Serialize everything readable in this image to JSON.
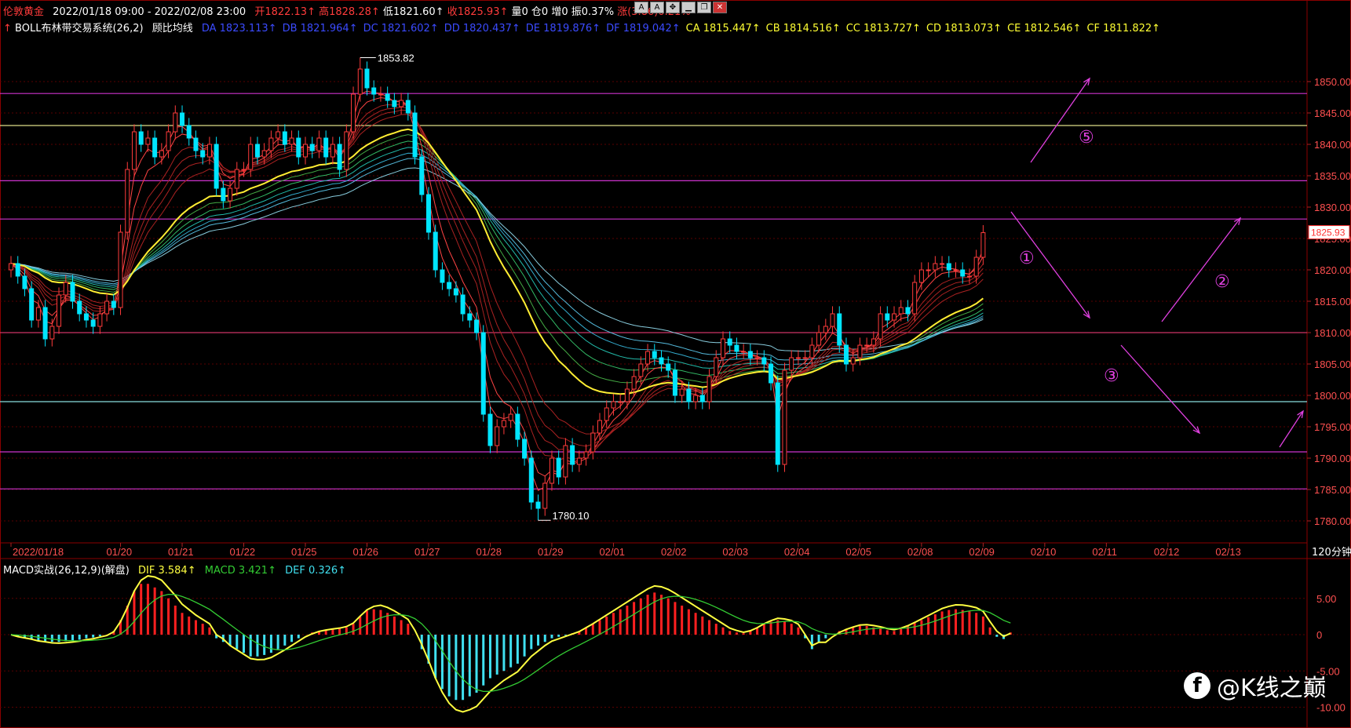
{
  "header": {
    "instrument": "伦敦黄金",
    "range": "2022/01/18 09:00 - 2022/02/08 23:00",
    "open": "开1822.13↑",
    "high": "高1828.28↑",
    "low": "低1821.60↑",
    "close": "收1825.93↑",
    "volume": "量0",
    "position": "仓0",
    "increase": "增0",
    "amplitude": "振0.37%",
    "change": "涨(3.86)0.21%",
    "colors": {
      "up": "#ff3b3b",
      "down": "#00e5ff",
      "label": "#ffffff"
    }
  },
  "indicator": {
    "name": "BOLL布林带交易系统(26,2)",
    "sub": "顾比均线",
    "items": [
      {
        "text": "DA 1823.113↑",
        "color": "#3b4bff"
      },
      {
        "text": "DB 1821.964↑",
        "color": "#3b4bff"
      },
      {
        "text": "DC 1821.602↑",
        "color": "#3b4bff"
      },
      {
        "text": "DD 1820.437↑",
        "color": "#3b4bff"
      },
      {
        "text": "DE 1819.876↑",
        "color": "#3b4bff"
      },
      {
        "text": "DF 1819.042↑",
        "color": "#3b4bff"
      },
      {
        "text": "CA 1815.447↑",
        "color": "#ffff33"
      },
      {
        "text": "CB 1814.516↑",
        "color": "#ffff33"
      },
      {
        "text": "CC 1813.727↑",
        "color": "#ffff33"
      },
      {
        "text": "CD 1813.073↑",
        "color": "#ffff33"
      },
      {
        "text": "CE 1812.546↑",
        "color": "#ffff33"
      },
      {
        "text": "CF 1811.822↑",
        "color": "#ffff33"
      }
    ]
  },
  "window_buttons": [
    "A",
    "A",
    "✥",
    "▁",
    "❐",
    "✕"
  ],
  "chart_data": {
    "type": "candlestick",
    "timeframe": "120分钟",
    "ylim": [
      1776.5,
      1857.5
    ],
    "yticks": [
      1850,
      1845,
      1840,
      1835,
      1830,
      1825,
      1820,
      1815,
      1810,
      1805,
      1800,
      1795,
      1790,
      1785,
      1780
    ],
    "ytick_labels": [
      "1850.00",
      "1845.00",
      "1840.00",
      "1835.00",
      "1830.00",
      "1825.00",
      "1820.00",
      "1815.00",
      "1810.00",
      "1805.00",
      "1800.00",
      "1795.00",
      "1790.00",
      "1785.00",
      "1780.00"
    ],
    "x_labels": [
      "2022/01/18",
      "01/20",
      "01/21",
      "01/22",
      "01/25",
      "01/26",
      "01/27",
      "01/28",
      "01/29",
      "02/01",
      "02/02",
      "02/03",
      "02/04",
      "02/05",
      "02/08",
      "02/09",
      "02/10",
      "02/11",
      "02/12",
      "02/13"
    ],
    "x_index": [
      0,
      16,
      25,
      34,
      43,
      52,
      61,
      70,
      79,
      88,
      97,
      106,
      115,
      124,
      133,
      142,
      151,
      160,
      169,
      178
    ],
    "last_price": "1825.93",
    "high_label": "1853.82",
    "low_label": "1780.10",
    "high_value": 1853.82,
    "low_value": 1780.1,
    "high_index": 51,
    "low_index": 77,
    "closes": [
      1821,
      1819,
      1817,
      1812,
      1814,
      1809,
      1811,
      1816,
      1818,
      1815,
      1813,
      1812,
      1811,
      1813,
      1815,
      1814,
      1826,
      1836,
      1842,
      1840,
      1841,
      1838,
      1839,
      1842,
      1845,
      1843,
      1841,
      1839,
      1838,
      1840,
      1833,
      1831,
      1833,
      1836,
      1836,
      1840,
      1838,
      1839,
      1841,
      1842,
      1840,
      1841,
      1838,
      1840,
      1839,
      1841,
      1838,
      1840,
      1836,
      1842,
      1848,
      1852,
      1849,
      1848,
      1848,
      1847,
      1846,
      1847,
      1845,
      1838,
      1832,
      1826,
      1820,
      1818,
      1817,
      1816,
      1813,
      1812,
      1810,
      1797,
      1792,
      1795,
      1796,
      1797,
      1793,
      1790,
      1783,
      1782,
      1786,
      1790,
      1787,
      1792,
      1789,
      1790,
      1791,
      1794,
      1796,
      1798,
      1799,
      1799,
      1801,
      1803,
      1805,
      1807,
      1806,
      1805,
      1804,
      1800,
      1801,
      1799,
      1800,
      1799,
      1803,
      1806,
      1809,
      1808,
      1807,
      1807,
      1806,
      1806,
      1805,
      1802,
      1789,
      1804,
      1806,
      1806,
      1806,
      1808,
      1810,
      1811,
      1813,
      1808,
      1805,
      1806,
      1808,
      1808,
      1809,
      1813,
      1812,
      1813,
      1814,
      1813,
      1818,
      1820,
      1820,
      1821,
      1821,
      1820,
      1820,
      1819,
      1819,
      1822,
      1825.93
    ],
    "gmma_labels": [],
    "horizontal_lines": [
      {
        "value": 1848.1,
        "color": "#cc33cc"
      },
      {
        "value": 1843.0,
        "color": "#dddd88"
      },
      {
        "value": 1834.2,
        "color": "#cc33cc"
      },
      {
        "value": 1828.1,
        "color": "#cc33cc"
      },
      {
        "value": 1810.0,
        "color": "#cc3366"
      },
      {
        "value": 1799.0,
        "color": "#88dddd"
      },
      {
        "value": 1791.0,
        "color": "#cc33cc"
      },
      {
        "value": 1785.1,
        "color": "#cc33cc"
      }
    ],
    "scenario_labels": [
      "①",
      "②",
      "③",
      "⑤"
    ],
    "scenario_color": "#e040e0"
  },
  "macd": {
    "name": "MACD实战(26,12,9)(解盘)",
    "dif": "DIF 3.584↑",
    "macd": "MACD 3.421↑",
    "def": "DEF 0.326↑",
    "yticks": [
      "5.00",
      "0",
      "-5.00",
      "-10.00"
    ],
    "ylim": [
      -12,
      8
    ],
    "values": [
      0,
      -0.3,
      -0.5,
      -0.6,
      -0.8,
      -0.9,
      -1,
      -1,
      -0.9,
      -0.8,
      -0.7,
      -0.5,
      -0.4,
      -0.2,
      0,
      0.5,
      2,
      4,
      6,
      7,
      7,
      6.5,
      6,
      5,
      4,
      3,
      2.5,
      2,
      1.5,
      1,
      -0.5,
      -1,
      -1.5,
      -2,
      -2.5,
      -3,
      -3,
      -2.8,
      -2.5,
      -2,
      -1.5,
      -1,
      -0.5,
      0,
      0.3,
      0.5,
      0.6,
      0.7,
      0.8,
      1,
      1.5,
      2.5,
      3.3,
      3.5,
      3.4,
      3,
      2.5,
      2,
      1.5,
      0,
      -2,
      -4,
      -6,
      -7.5,
      -8.5,
      -9,
      -9,
      -8.5,
      -8,
      -7,
      -6,
      -5.5,
      -5,
      -4.5,
      -4,
      -3,
      -2,
      -1.5,
      -1,
      -0.5,
      -0.3,
      -0.1,
      0.2,
      0.5,
      1,
      1.5,
      2,
      2.5,
      3,
      3.5,
      4,
      4.5,
      5,
      5.5,
      5.8,
      5.5,
      5,
      4.5,
      4,
      3.5,
      3,
      2.5,
      2,
      1.5,
      1,
      0.5,
      0.3,
      0.2,
      0.5,
      1,
      1.5,
      1.8,
      2,
      1.8,
      1.5,
      1,
      -0.5,
      -2,
      -1,
      -0.5,
      0,
      0.5,
      0.8,
      1,
      1.2,
      1.2,
      1,
      0.8,
      0.6,
      0.5,
      0.8,
      1.2,
      1.6,
      2,
      2.4,
      2.8,
      3.2,
      3.4,
      3.5,
      3.4,
      3.2,
      3,
      2.5,
      1,
      -0.3,
      -0.6,
      0.3
    ],
    "colors": {
      "pos": "#ff2020",
      "neg": "#40e0f0",
      "dif": "#ffff40",
      "dea": "#33cc33"
    }
  },
  "watermark": "@K线之巅"
}
